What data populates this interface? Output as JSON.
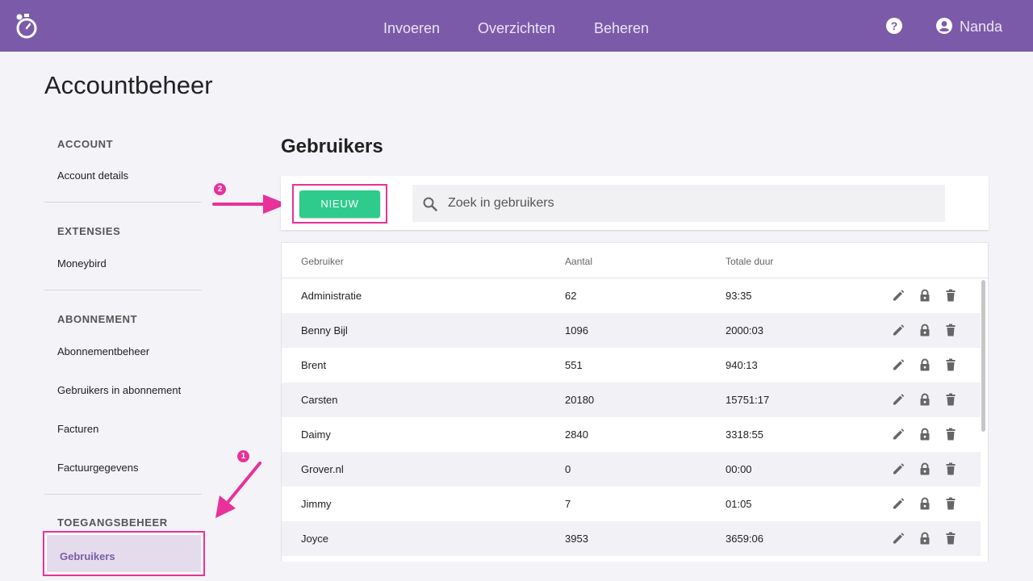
{
  "header": {
    "nav": [
      "Invoeren",
      "Overzichten",
      "Beheren"
    ],
    "help_glyph": "?",
    "user_name": "Nanda"
  },
  "page": {
    "title": "Accountbeheer"
  },
  "sidebar": {
    "sections": [
      {
        "heading": "ACCOUNT",
        "items": [
          "Account details"
        ]
      },
      {
        "heading": "EXTENSIES",
        "items": [
          "Moneybird"
        ]
      },
      {
        "heading": "ABONNEMENT",
        "items": [
          "Abonnementbeheer",
          "Gebruikers in abonnement",
          "Facturen",
          "Factuurgegevens"
        ]
      },
      {
        "heading": "TOEGANGSBEHEER",
        "items": [
          "Gebruikers"
        ]
      }
    ],
    "active_item": "Gebruikers"
  },
  "annotations": {
    "badge_1": "1",
    "badge_2": "2",
    "color": "#e8319a"
  },
  "main": {
    "title": "Gebruikers",
    "new_button": "NIEUW",
    "search_placeholder": "Zoek in gebruikers",
    "table": {
      "headers": [
        "Gebruiker",
        "Aantal",
        "Totale duur"
      ],
      "rows": [
        [
          "Administratie",
          "62",
          "93:35"
        ],
        [
          "Benny Bijl",
          "1096",
          "2000:03"
        ],
        [
          "Brent",
          "551",
          "940:13"
        ],
        [
          "Carsten",
          "20180",
          "15751:17"
        ],
        [
          "Daimy",
          "2840",
          "3318:55"
        ],
        [
          "Grover.nl",
          "0",
          "00:00"
        ],
        [
          "Jimmy",
          "7",
          "01:05"
        ],
        [
          "Joyce",
          "3953",
          "3659:06"
        ]
      ],
      "row_actions": [
        "edit-icon",
        "lock-icon",
        "trash-icon"
      ]
    }
  },
  "colors": {
    "brand": "#7b5ba9",
    "accent_green": "#2ecb8d",
    "highlight": "#e8319a"
  }
}
